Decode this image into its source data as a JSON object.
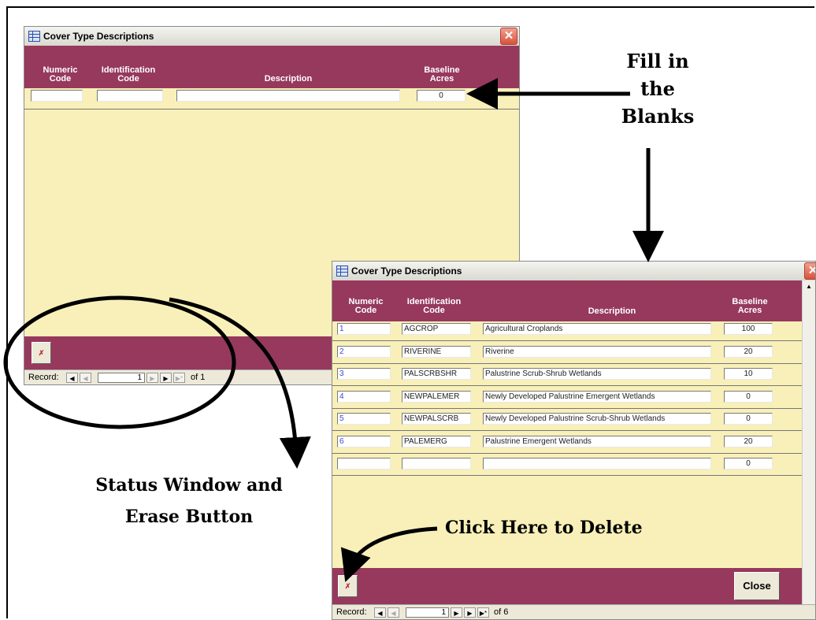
{
  "window": {
    "title": "Cover Type Descriptions",
    "columns": {
      "numeric_code": "Numeric\nCode",
      "identification_code": "Identification\nCode",
      "description": "Description",
      "baseline_acres": "Baseline\nAcres"
    },
    "close_glyph": "✕",
    "delete_glyph": "✗",
    "close_button_label": "Close"
  },
  "window1": {
    "rows": [
      {
        "numeric": "",
        "id": "",
        "description": "",
        "acres": "0"
      }
    ],
    "nav": {
      "label": "Record:",
      "current": "1",
      "of_text": "of 1"
    }
  },
  "window2": {
    "rows": [
      {
        "numeric": "1",
        "id": "AGCROP",
        "description": "Agricultural Croplands",
        "acres": "100"
      },
      {
        "numeric": "2",
        "id": "RIVERINE",
        "description": "Riverine",
        "acres": "20"
      },
      {
        "numeric": "3",
        "id": "PALSCRBSHR",
        "description": "Palustrine Scrub-Shrub Wetlands",
        "acres": "10"
      },
      {
        "numeric": "4",
        "id": "NEWPALEMER",
        "description": "Newly Developed Palustrine Emergent Wetlands",
        "acres": "0"
      },
      {
        "numeric": "5",
        "id": "NEWPALSCRB",
        "description": "Newly Developed Palustrine Scrub-Shrub Wetlands",
        "acres": "0"
      },
      {
        "numeric": "6",
        "id": "PALEMERG",
        "description": "Palustrine Emergent Wetlands",
        "acres": "20"
      },
      {
        "numeric": "",
        "id": "",
        "description": "",
        "acres": "0"
      }
    ],
    "nav": {
      "label": "Record:",
      "current": "1",
      "of_text": "of 6"
    }
  },
  "nav_glyphs": {
    "first": "◀",
    "prev": "◀",
    "next": "▶",
    "last": "▶",
    "new": "▶*"
  },
  "callouts": {
    "fill_blanks": "Fill in\nthe\nBlanks",
    "status_window": "Status Window and\nErase Button",
    "click_delete": "Click Here to Delete"
  }
}
